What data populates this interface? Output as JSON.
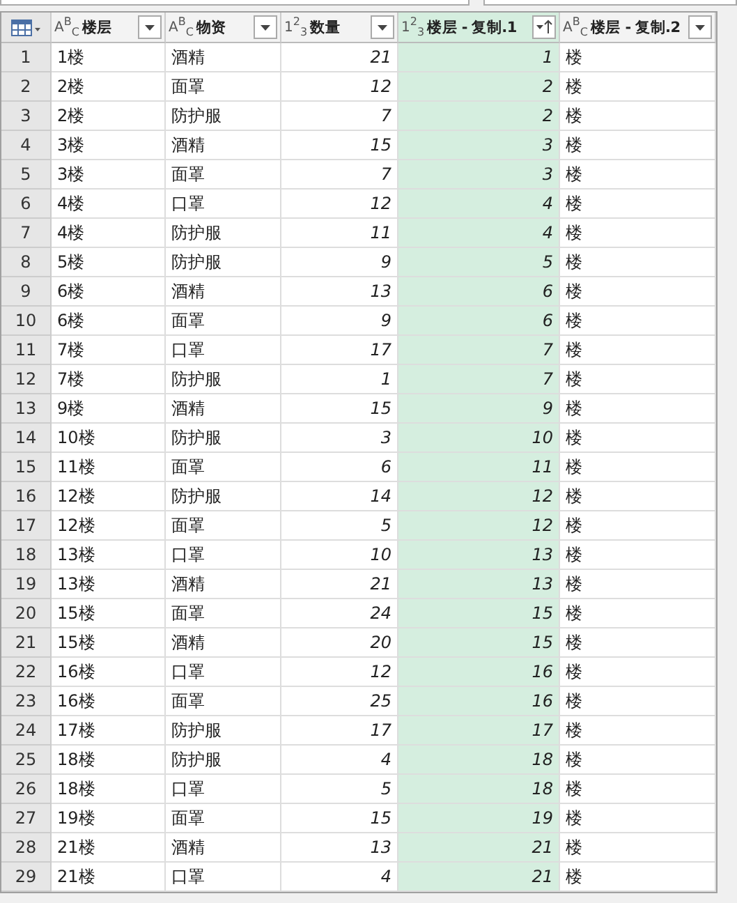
{
  "columns": [
    {
      "kind": "text",
      "type_icon": "A$^{B}$$_{C}$",
      "label": "楼层",
      "selected": false,
      "sorted": false
    },
    {
      "kind": "text",
      "type_icon": "A$^{B}$$_{C}$",
      "label": "物资",
      "selected": false,
      "sorted": false
    },
    {
      "kind": "number",
      "type_icon": "1$^{2}$$_{3}$",
      "label": "数量",
      "selected": false,
      "sorted": false
    },
    {
      "kind": "number",
      "type_icon": "1$^{2}$$_{3}$",
      "label": "楼层 - 复制.1",
      "selected": true,
      "sorted": true
    },
    {
      "kind": "text",
      "type_icon": "A$^{B}$$_{C}$",
      "label": "楼层 - 复制.2",
      "selected": false,
      "sorted": false
    }
  ],
  "rows": [
    {
      "n": "1",
      "cells": [
        "1楼",
        "酒精",
        "21",
        "1",
        "楼"
      ]
    },
    {
      "n": "2",
      "cells": [
        "2楼",
        "面罩",
        "12",
        "2",
        "楼"
      ]
    },
    {
      "n": "3",
      "cells": [
        "2楼",
        "防护服",
        "7",
        "2",
        "楼"
      ]
    },
    {
      "n": "4",
      "cells": [
        "3楼",
        "酒精",
        "15",
        "3",
        "楼"
      ]
    },
    {
      "n": "5",
      "cells": [
        "3楼",
        "面罩",
        "7",
        "3",
        "楼"
      ]
    },
    {
      "n": "6",
      "cells": [
        "4楼",
        "口罩",
        "12",
        "4",
        "楼"
      ]
    },
    {
      "n": "7",
      "cells": [
        "4楼",
        "防护服",
        "11",
        "4",
        "楼"
      ]
    },
    {
      "n": "8",
      "cells": [
        "5楼",
        "防护服",
        "9",
        "5",
        "楼"
      ]
    },
    {
      "n": "9",
      "cells": [
        "6楼",
        "酒精",
        "13",
        "6",
        "楼"
      ]
    },
    {
      "n": "10",
      "cells": [
        "6楼",
        "面罩",
        "9",
        "6",
        "楼"
      ]
    },
    {
      "n": "11",
      "cells": [
        "7楼",
        "口罩",
        "17",
        "7",
        "楼"
      ]
    },
    {
      "n": "12",
      "cells": [
        "7楼",
        "防护服",
        "1",
        "7",
        "楼"
      ]
    },
    {
      "n": "13",
      "cells": [
        "9楼",
        "酒精",
        "15",
        "9",
        "楼"
      ]
    },
    {
      "n": "14",
      "cells": [
        "10楼",
        "防护服",
        "3",
        "10",
        "楼"
      ]
    },
    {
      "n": "15",
      "cells": [
        "11楼",
        "面罩",
        "6",
        "11",
        "楼"
      ]
    },
    {
      "n": "16",
      "cells": [
        "12楼",
        "防护服",
        "14",
        "12",
        "楼"
      ]
    },
    {
      "n": "17",
      "cells": [
        "12楼",
        "面罩",
        "5",
        "12",
        "楼"
      ]
    },
    {
      "n": "18",
      "cells": [
        "13楼",
        "口罩",
        "10",
        "13",
        "楼"
      ]
    },
    {
      "n": "19",
      "cells": [
        "13楼",
        "酒精",
        "21",
        "13",
        "楼"
      ]
    },
    {
      "n": "20",
      "cells": [
        "15楼",
        "面罩",
        "24",
        "15",
        "楼"
      ]
    },
    {
      "n": "21",
      "cells": [
        "15楼",
        "酒精",
        "20",
        "15",
        "楼"
      ]
    },
    {
      "n": "22",
      "cells": [
        "16楼",
        "口罩",
        "12",
        "16",
        "楼"
      ]
    },
    {
      "n": "23",
      "cells": [
        "16楼",
        "面罩",
        "25",
        "16",
        "楼"
      ]
    },
    {
      "n": "24",
      "cells": [
        "17楼",
        "防护服",
        "17",
        "17",
        "楼"
      ]
    },
    {
      "n": "25",
      "cells": [
        "18楼",
        "防护服",
        "4",
        "18",
        "楼"
      ]
    },
    {
      "n": "26",
      "cells": [
        "18楼",
        "口罩",
        "5",
        "18",
        "楼"
      ]
    },
    {
      "n": "27",
      "cells": [
        "19楼",
        "面罩",
        "15",
        "19",
        "楼"
      ]
    },
    {
      "n": "28",
      "cells": [
        "21楼",
        "酒精",
        "13",
        "21",
        "楼"
      ]
    },
    {
      "n": "29",
      "cells": [
        "21楼",
        "口罩",
        "4",
        "21",
        "楼"
      ]
    }
  ]
}
